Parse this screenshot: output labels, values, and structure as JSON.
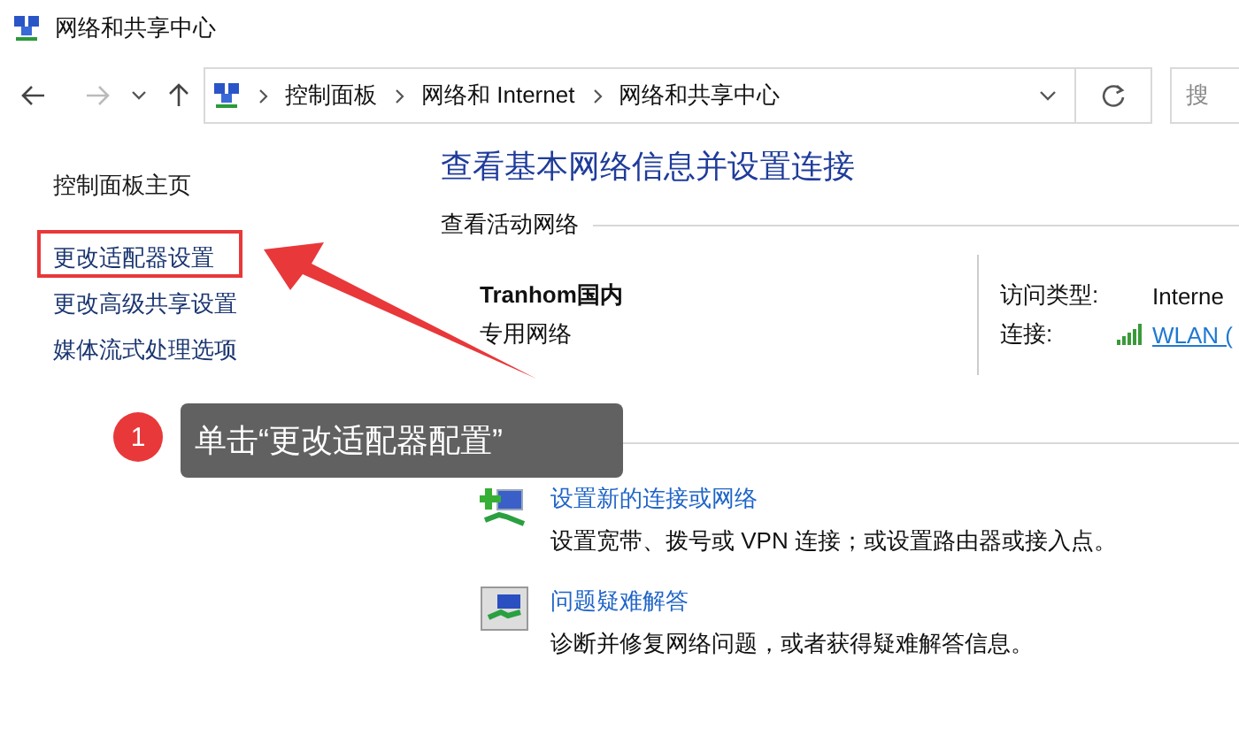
{
  "window": {
    "title": "网络和共享中心"
  },
  "address_bar": {
    "breadcrumbs": [
      "控制面板",
      "网络和 Internet",
      "网络和共享中心"
    ],
    "search_placeholder": "搜"
  },
  "sidebar": {
    "items": [
      {
        "label": "控制面板主页",
        "kind": "home"
      },
      {
        "label": "更改适配器设置",
        "kind": "link"
      },
      {
        "label": "更改高级共享设置",
        "kind": "link"
      },
      {
        "label": "媒体流式处理选项",
        "kind": "link"
      }
    ]
  },
  "main": {
    "heading": "查看基本网络信息并设置连接",
    "active_networks_label": "查看活动网络",
    "network": {
      "name": "Tranhom国内",
      "category": "专用网络",
      "access_type_label": "访问类型:",
      "access_type": "Interne",
      "connection_label": "连接:",
      "connection": "WLAN ("
    },
    "tasks": [
      {
        "kind": "new-connection",
        "title": "设置新的连接或网络",
        "description": "设置宽带、拨号或 VPN 连接；或设置路由器或接入点。"
      },
      {
        "kind": "troubleshoot",
        "title": "问题疑难解答",
        "description": "诊断并修复网络问题，或者获得疑难解答信息。"
      }
    ]
  },
  "annotation": {
    "step": "1",
    "text": "单击“更改适配器配置”"
  }
}
